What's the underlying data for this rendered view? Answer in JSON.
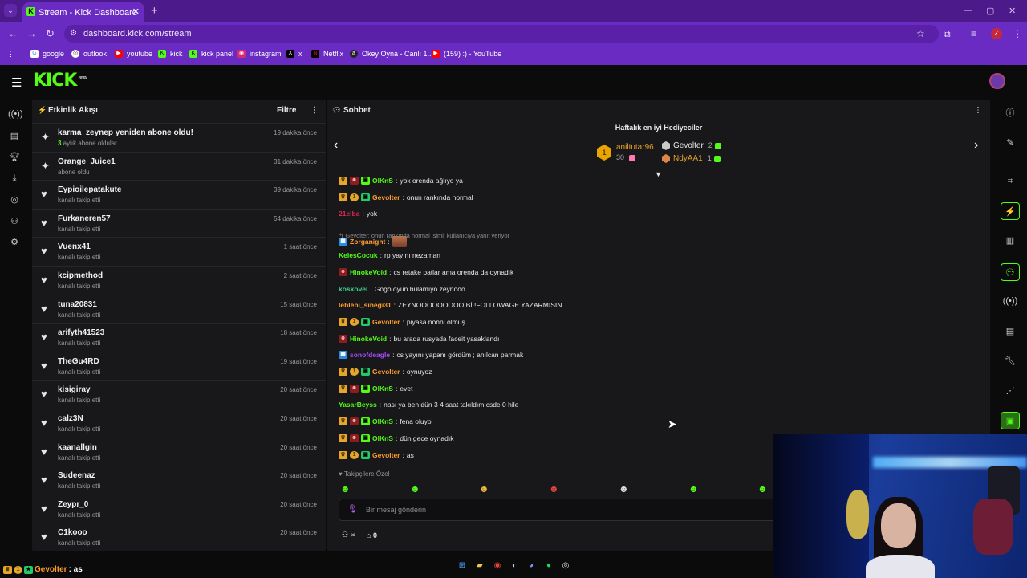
{
  "browser": {
    "tab_title": "Stream - Kick Dashboard",
    "url": "dashboard.kick.com/stream",
    "bookmarks": [
      "google",
      "outlook",
      "youtube",
      "kick",
      "kick panel",
      "instagram",
      "x",
      "Netflix",
      "Okey Oyna - Canlı 1...",
      "(159) :) - YouTube"
    ]
  },
  "kick": {
    "logo": "KICK",
    "logo_sup": "BETA"
  },
  "activity": {
    "title": "Etkinlik Akışı",
    "filter": "Filtre",
    "events": [
      {
        "icon": "sparkle",
        "name": "karma_zeynep yeniden abone oldu!",
        "sub_highlight": "3",
        "sub": " aylık abone oldular",
        "time": "19 dakika önce"
      },
      {
        "icon": "sparkle",
        "name": "Orange_Juice1",
        "sub_highlight": "",
        "sub": "abone oldu",
        "time": "31 dakika önce"
      },
      {
        "icon": "heart",
        "name": "Eypioilepatakute",
        "sub_highlight": "",
        "sub": "kanalı takip etti",
        "time": "39 dakika önce"
      },
      {
        "icon": "heart",
        "name": "Furkaneren57",
        "sub_highlight": "",
        "sub": "kanalı takip etti",
        "time": "54 dakika önce"
      },
      {
        "icon": "heart",
        "name": "Vuenx41",
        "sub_highlight": "",
        "sub": "kanalı takip etti",
        "time": "1 saat önce"
      },
      {
        "icon": "heart",
        "name": "kcipmethod",
        "sub_highlight": "",
        "sub": "kanalı takip etti",
        "time": "2 saat önce"
      },
      {
        "icon": "heart",
        "name": "tuna20831",
        "sub_highlight": "",
        "sub": "kanalı takip etti",
        "time": "15 saat önce"
      },
      {
        "icon": "heart",
        "name": "arifyth41523",
        "sub_highlight": "",
        "sub": "kanalı takip etti",
        "time": "18 saat önce"
      },
      {
        "icon": "heart",
        "name": "TheGu4RD",
        "sub_highlight": "",
        "sub": "kanalı takip etti",
        "time": "19 saat önce"
      },
      {
        "icon": "heart",
        "name": "kisigiray",
        "sub_highlight": "",
        "sub": "kanalı takip etti",
        "time": "20 saat önce"
      },
      {
        "icon": "heart",
        "name": "calz3N",
        "sub_highlight": "",
        "sub": "kanalı takip etti",
        "time": "20 saat önce"
      },
      {
        "icon": "heart",
        "name": "kaanallgin",
        "sub_highlight": "",
        "sub": "kanalı takip etti",
        "time": "20 saat önce"
      },
      {
        "icon": "heart",
        "name": "Sudeenaz",
        "sub_highlight": "",
        "sub": "kanalı takip etti",
        "time": "20 saat önce"
      },
      {
        "icon": "heart",
        "name": "Zeypr_0",
        "sub_highlight": "",
        "sub": "kanalı takip etti",
        "time": "20 saat önce"
      },
      {
        "icon": "heart",
        "name": "C1kooo",
        "sub_highlight": "",
        "sub": "kanalı takip etti",
        "time": "20 saat önce"
      }
    ]
  },
  "chat": {
    "title": "Sohbet",
    "gifters_title": "Haftalık en iyi Hediyeciler",
    "top_gifter": {
      "rank": "1",
      "name": "aniltutar96",
      "count": "30"
    },
    "gifter2": {
      "name": "Gevolter",
      "count": "2",
      "medal_color": "#c9c9c9"
    },
    "gifter3": {
      "name": "NdyAA1",
      "count": "1",
      "medal_color": "#e0854a"
    },
    "messages": [
      {
        "badges": [
          "crown",
          "mask",
          "gift"
        ],
        "user": "OlKnS",
        "color": "#53fc18",
        "text": "yok orenda ağlıyo ya"
      },
      {
        "badges": [
          "crown",
          "one",
          "sub"
        ],
        "user": "Gevolter",
        "color": "#ff9d2e",
        "text": "onun rankında normal"
      },
      {
        "badges": [],
        "user": "21elba",
        "color": "#e0264f",
        "text": "yok"
      },
      {
        "badges": [
          "cube"
        ],
        "user": "Zorganight",
        "color": "#ff9d2e",
        "text": "",
        "reply": "Gevolter: onun rankında normal isimli kullanıcıya yanıt veriyor",
        "emote": true
      },
      {
        "badges": [],
        "user": "KelesCocuk",
        "color": "#53fc18",
        "text": "rp yayını nezaman"
      },
      {
        "badges": [
          "mask"
        ],
        "user": "HinokeVoid",
        "color": "#53fc18",
        "text": "cs retake patlar ama orenda da oynadık"
      },
      {
        "badges": [],
        "user": "koskovel",
        "color": "#3fd38c",
        "text": "Gogo oyun bulamıyo zeynooo"
      },
      {
        "badges": [],
        "user": "leblebi_sinegi31",
        "color": "#ff9d2e",
        "text": "ZEYNOOOOOOOOO Bİ !FOLLOWAGE YAZARMISIN"
      },
      {
        "badges": [
          "crown",
          "one",
          "sub"
        ],
        "user": "Gevolter",
        "color": "#ff9d2e",
        "text": "piyasa nonni olmuş"
      },
      {
        "badges": [
          "mask"
        ],
        "user": "HinokeVoid",
        "color": "#53fc18",
        "text": "bu arada rusyada faceit yasaklandı"
      },
      {
        "badges": [
          "cube"
        ],
        "user": "sonofdeagle",
        "color": "#a64dff",
        "text": "cs yayını yapanı gördüm ; anılcan parmak"
      },
      {
        "badges": [
          "crown",
          "one",
          "sub"
        ],
        "user": "Gevolter",
        "color": "#ff9d2e",
        "text": "oynuyoz"
      },
      {
        "badges": [
          "crown",
          "mask",
          "gift"
        ],
        "user": "OlKnS",
        "color": "#53fc18",
        "text": "evet"
      },
      {
        "badges": [],
        "user": "YasarBeyss",
        "color": "#53fc18",
        "text": "nası ya ben dün 3 4 saat takıldım csde 0 hile"
      },
      {
        "badges": [
          "crown",
          "mask",
          "gift"
        ],
        "user": "OlKnS",
        "color": "#53fc18",
        "text": "fena oluyo"
      },
      {
        "badges": [
          "crown",
          "mask",
          "gift"
        ],
        "user": "OlKnS",
        "color": "#53fc18",
        "text": "dün gece oynadık"
      },
      {
        "badges": [
          "crown",
          "one",
          "sub"
        ],
        "user": "Gevolter",
        "color": "#ff9d2e",
        "text": "as"
      }
    ],
    "followers_only": "Takipçilere Özel",
    "input_placeholder": "Bir mesaj gönderin",
    "footer_count": "0"
  },
  "overlay": {
    "user": "Gevolter",
    "text": " : as"
  },
  "colors": {
    "accent": "#53fc18",
    "browser": "#6a2bc2"
  }
}
